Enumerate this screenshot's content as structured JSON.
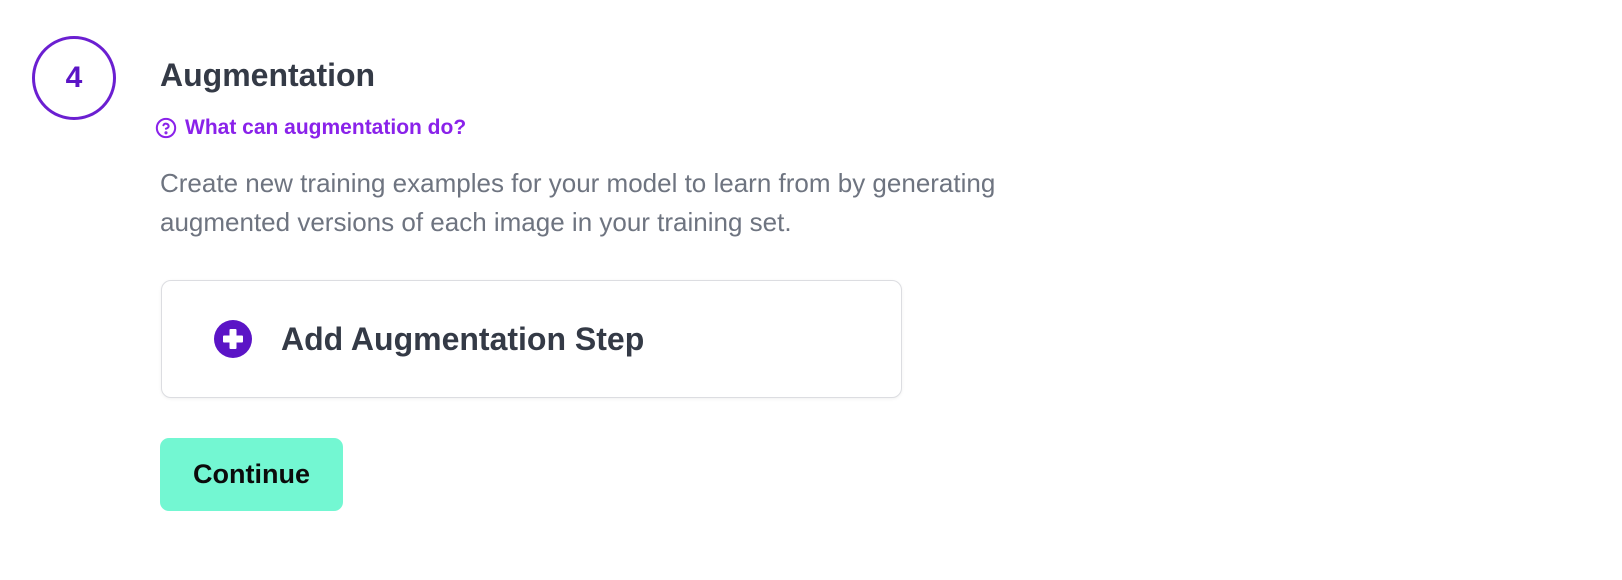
{
  "step": {
    "number": "4",
    "title": "Augmentation"
  },
  "help_link": {
    "icon": "question-circle-icon",
    "label": "What can augmentation do?"
  },
  "description": "Create new training examples for your model to learn from by generating augmented versions of each image in your training set.",
  "add_step": {
    "icon": "plus-circle-icon",
    "label": "Add Augmentation Step"
  },
  "continue_button": {
    "label": "Continue"
  },
  "colors": {
    "accent_purple": "#5b14c6",
    "link_purple": "#8a22ea",
    "continue_bg": "#73f7d2",
    "heading_text": "#343a46",
    "body_text": "#6e7480"
  }
}
